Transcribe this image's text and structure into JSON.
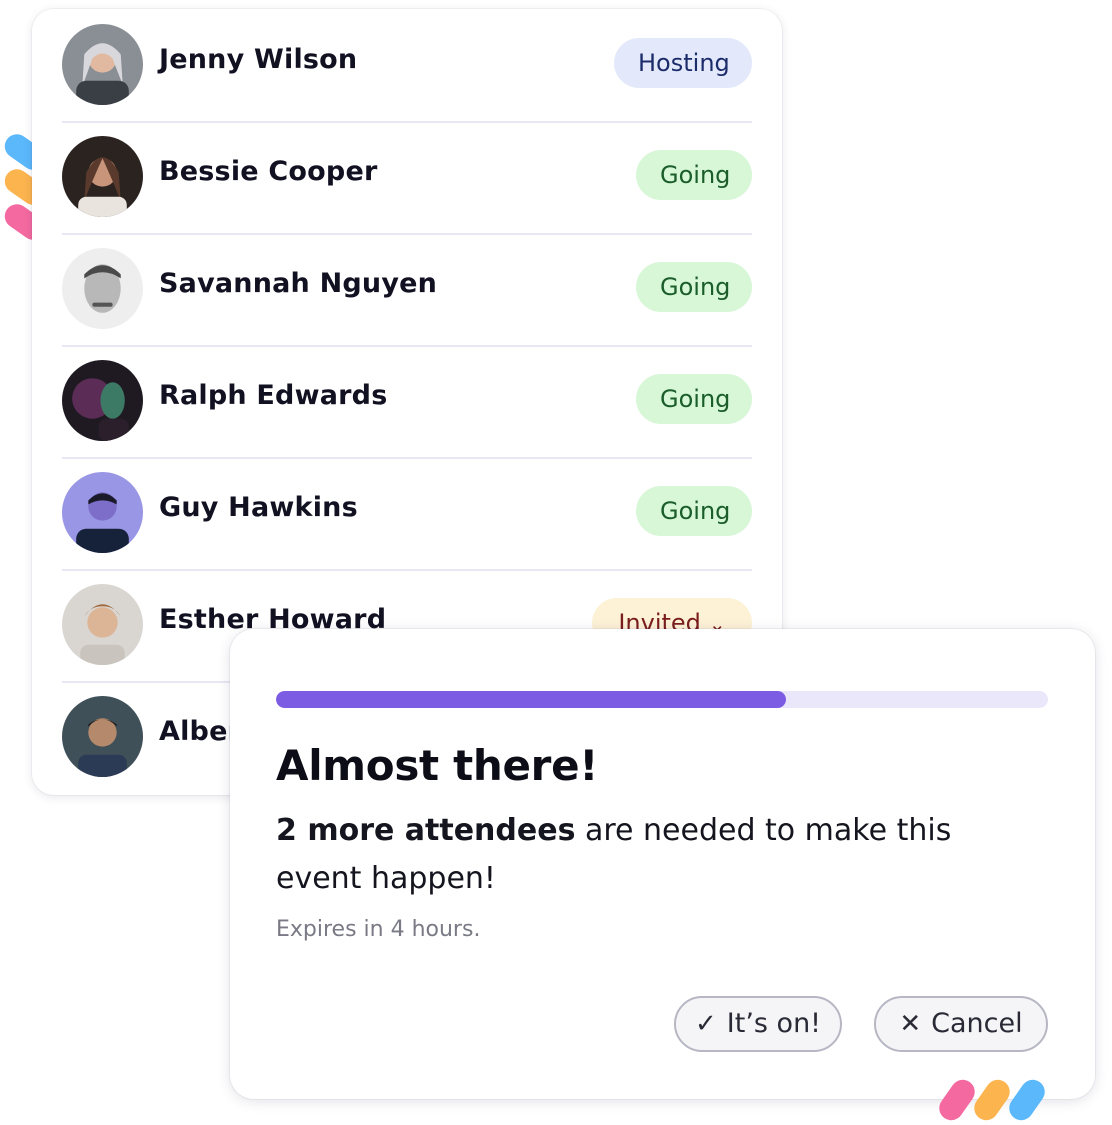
{
  "attendees": [
    {
      "name": "Jenny Wilson",
      "status": "Hosting",
      "status_type": "hosting"
    },
    {
      "name": "Bessie Cooper",
      "status": "Going",
      "status_type": "going"
    },
    {
      "name": "Savannah Nguyen",
      "status": "Going",
      "status_type": "going"
    },
    {
      "name": "Ralph Edwards",
      "status": "Going",
      "status_type": "going"
    },
    {
      "name": "Guy Hawkins",
      "status": "Going",
      "status_type": "going"
    },
    {
      "name": "Esther Howard",
      "status": "Invited",
      "status_type": "invited",
      "icon": "chevron-down-icon"
    },
    {
      "name": "Albert Flores",
      "status": "",
      "status_type": ""
    }
  ],
  "dialog": {
    "progress_percent": 66,
    "title": "Almost there!",
    "body_bold": "2 more attendees",
    "body_rest": " are needed to make this event happen!",
    "expires": "Expires in 4 hours.",
    "confirm_label": "It’s on!",
    "confirm_icon": "check-icon",
    "cancel_label": "Cancel",
    "cancel_icon": "close-icon"
  },
  "colors": {
    "accent": "#7b5ce3",
    "progress_track": "#ebe7fb",
    "hosting_bg": "#e3e9fb",
    "going_bg": "#d7f7d6",
    "invited_bg": "#fdf1d6",
    "pill_blue": "#5bb8fb",
    "pill_orange": "#fcb44f",
    "pill_pink": "#f46aa0"
  }
}
